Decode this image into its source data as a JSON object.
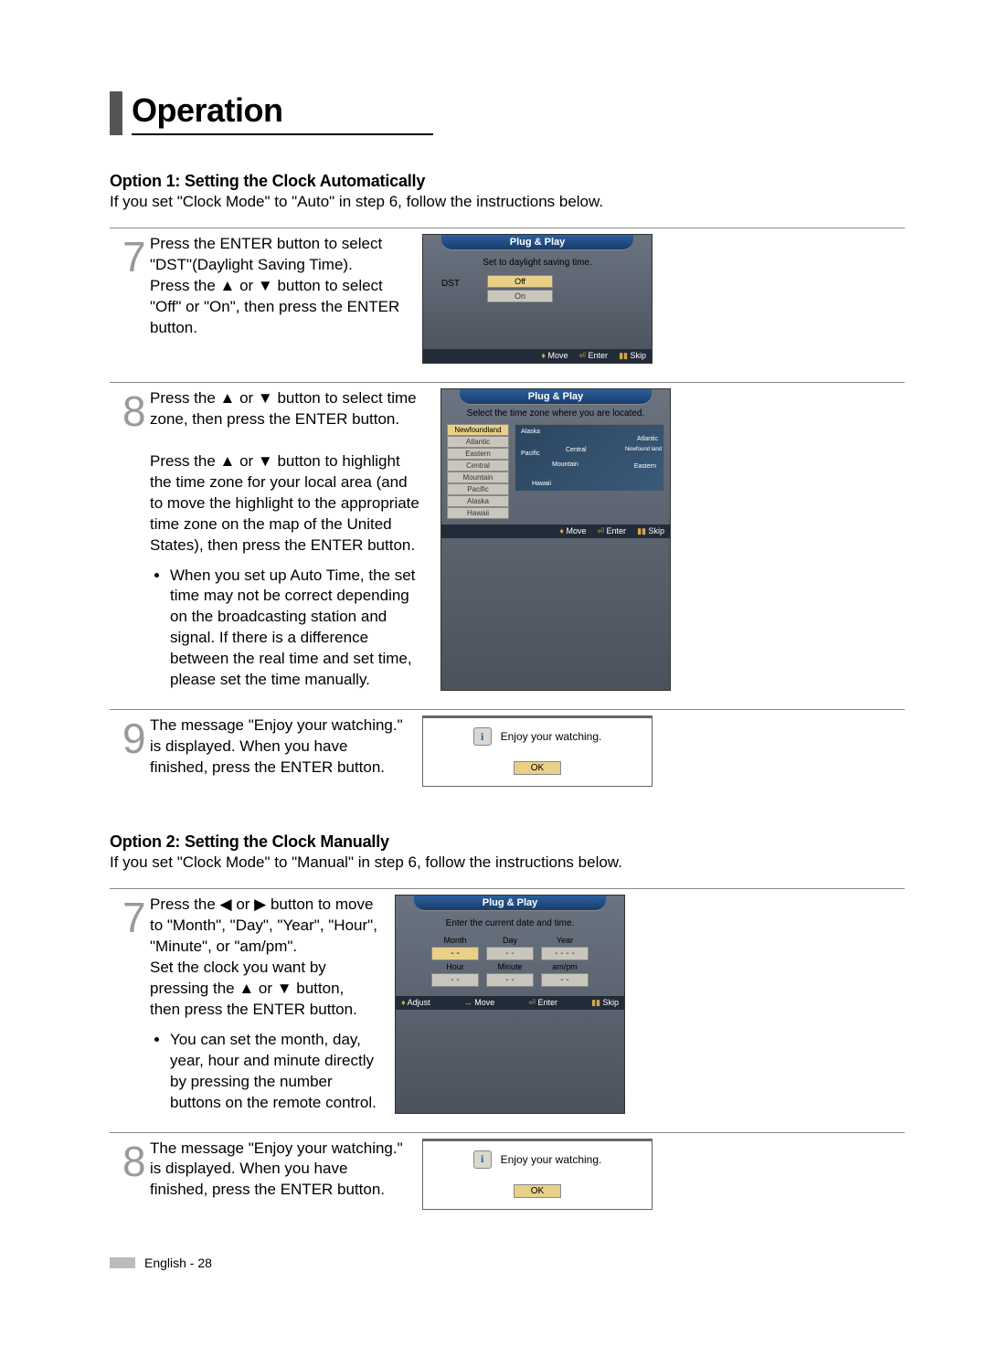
{
  "title": "Operation",
  "option1": {
    "heading": "Option 1: Setting the Clock Automatically",
    "sub": "If you set \"Clock Mode\" to \"Auto\" in step 6, follow the instructions below."
  },
  "step7": {
    "num": "7",
    "p1": "Press the ENTER button to select \"DST\"(Daylight Saving Time).",
    "p2": "Press the ▲ or ▼ button to select \"Off\" or \"On\", then press the ENTER button."
  },
  "osd_dst": {
    "title": "Plug & Play",
    "prompt": "Set to daylight saving time.",
    "label": "DST",
    "opt_off": "Off",
    "opt_on": "On",
    "move": "Move",
    "enter": "Enter",
    "skip": "Skip"
  },
  "step8": {
    "num": "8",
    "p1": "Press the ▲ or ▼ button to select time zone, then press the ENTER button.",
    "p2": "Press the ▲ or ▼ button to highlight the time zone for your local area (and to move the highlight to the appropriate time zone on the map of the United States), then press the ENTER button.",
    "note": "When you set up Auto Time, the set time may not be correct depending on the broadcasting station and signal. If there is a difference between the real time and set time, please set the time manually."
  },
  "osd_tz": {
    "title": "Plug & Play",
    "prompt": "Select the time zone where you are located.",
    "zones": [
      "Newfoundland",
      "Atlantic",
      "Eastern",
      "Central",
      "Mountain",
      "Pacific",
      "Alaska",
      "Hawaii"
    ],
    "map_labels": {
      "alaska": "Alaska",
      "pacific": "Pacific",
      "central": "Central",
      "mountain": "Mountain",
      "atlantic": "Atlantic",
      "eastern": "Eastern",
      "newfoundland": "Newfound land",
      "hawaii": "Hawaii"
    },
    "move": "Move",
    "enter": "Enter",
    "skip": "Skip"
  },
  "step9": {
    "num": "9",
    "text": "The message \"Enjoy your watching.\" is displayed. When you have finished, press the ENTER button."
  },
  "info1": {
    "msg": "Enjoy your watching.",
    "ok": "OK"
  },
  "option2": {
    "heading": "Option 2: Setting the Clock Manually",
    "sub": "If you set \"Clock Mode\" to \"Manual\" in step 6, follow the instructions below."
  },
  "step7b": {
    "num": "7",
    "p1": "Press the ◀ or ▶ button to move to \"Month\", \"Day\", \"Year\", \"Hour\", \"Minute\", or \"am/pm\".",
    "p2": "Set the clock you want by pressing the ▲ or ▼ button, then press the ENTER button.",
    "note": "You can set the month, day, year, hour and minute directly by pressing the number buttons on the remote control."
  },
  "osd_date": {
    "title": "Plug & Play",
    "prompt": "Enter the current date and time.",
    "labels": [
      "Month",
      "Day",
      "Year",
      "Hour",
      "Minute",
      "am/pm"
    ],
    "values": [
      "- -",
      "- -",
      "- - - -",
      "- -",
      "- -",
      "- -"
    ],
    "adjust": "Adjust",
    "move": "Move",
    "enter": "Enter",
    "skip": "Skip"
  },
  "step8b": {
    "num": "8",
    "text": "The message \"Enjoy your watching.\" is displayed. When you have finished, press the ENTER button."
  },
  "info2": {
    "msg": "Enjoy your watching.",
    "ok": "OK"
  },
  "footer": {
    "lang": "English - 28"
  }
}
